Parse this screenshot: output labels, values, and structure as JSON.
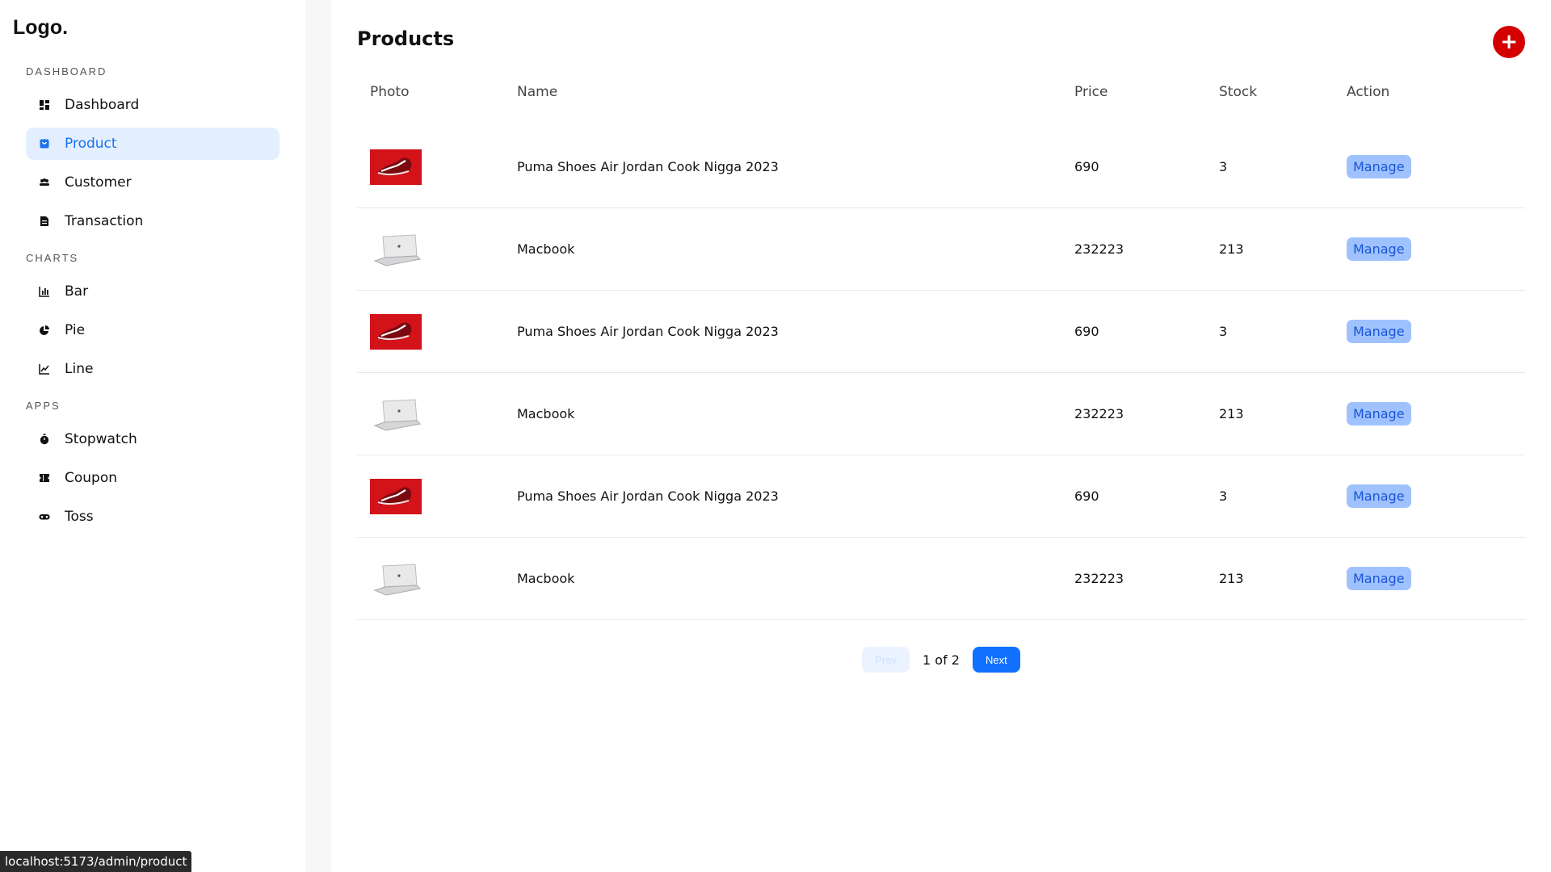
{
  "sidebar": {
    "logo": "Logo.",
    "sections": [
      {
        "heading": "DASHBOARD",
        "items": [
          {
            "label": "Dashboard",
            "icon": "dashboard-icon",
            "active": false
          },
          {
            "label": "Product",
            "icon": "bag-icon",
            "active": true
          },
          {
            "label": "Customer",
            "icon": "people-icon",
            "active": false
          },
          {
            "label": "Transaction",
            "icon": "document-icon",
            "active": false
          }
        ]
      },
      {
        "heading": "CHARTS",
        "items": [
          {
            "label": "Bar",
            "icon": "bar-chart-icon"
          },
          {
            "label": "Pie",
            "icon": "pie-chart-icon"
          },
          {
            "label": "Line",
            "icon": "line-chart-icon"
          }
        ]
      },
      {
        "heading": "APPS",
        "items": [
          {
            "label": "Stopwatch",
            "icon": "stopwatch-icon"
          },
          {
            "label": "Coupon",
            "icon": "coupon-icon"
          },
          {
            "label": "Toss",
            "icon": "gamepad-icon"
          }
        ]
      }
    ]
  },
  "main": {
    "title": "Products",
    "add_button_label": "+",
    "columns": [
      "Photo",
      "Name",
      "Price",
      "Stock",
      "Action"
    ],
    "rows": [
      {
        "photo": "red-shoe",
        "name": "Puma Shoes Air Jordan Cook Nigga 2023",
        "price": "690",
        "stock": "3",
        "action": "Manage"
      },
      {
        "photo": "laptop",
        "name": "Macbook",
        "price": "232223",
        "stock": "213",
        "action": "Manage"
      },
      {
        "photo": "red-shoe",
        "name": "Puma Shoes Air Jordan Cook Nigga 2023",
        "price": "690",
        "stock": "3",
        "action": "Manage"
      },
      {
        "photo": "laptop",
        "name": "Macbook",
        "price": "232223",
        "stock": "213",
        "action": "Manage"
      },
      {
        "photo": "red-shoe",
        "name": "Puma Shoes Air Jordan Cook Nigga 2023",
        "price": "690",
        "stock": "3",
        "action": "Manage"
      },
      {
        "photo": "laptop",
        "name": "Macbook",
        "price": "232223",
        "stock": "213",
        "action": "Manage"
      }
    ],
    "pagination": {
      "prev_label": "Prev",
      "next_label": "Next",
      "current_page": "1 of 2"
    }
  },
  "status_bar": {
    "url": "localhost:5173/admin/product"
  },
  "colors": {
    "accent": "#1070ff",
    "active_bg": "#e3efff",
    "add_button": "#d40000",
    "manage_bg": "#9fc2ff"
  }
}
